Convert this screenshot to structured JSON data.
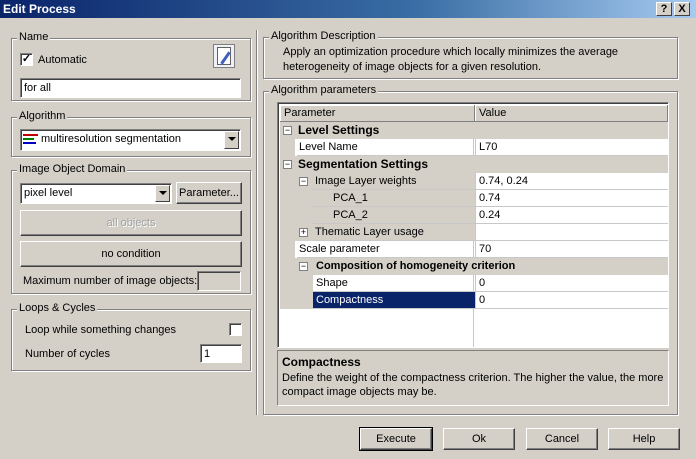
{
  "window": {
    "title": "Edit Process",
    "help_btn": "?",
    "close_btn": "X"
  },
  "name_group": {
    "legend": "Name",
    "automatic_label": "Automatic",
    "automatic_checked": true,
    "value": "for all"
  },
  "algorithm_group": {
    "legend": "Algorithm",
    "selected": "multiresolution segmentation"
  },
  "domain_group": {
    "legend": "Image Object Domain",
    "selected": "pixel level",
    "parameter_btn": "Parameter...",
    "all_objects_btn": "all objects",
    "no_condition_btn": "no condition",
    "max_objects_label": "Maximum number of image objects:"
  },
  "loops_group": {
    "legend": "Loops & Cycles",
    "loop_label": "Loop while something changes",
    "loop_checked": false,
    "cycles_label": "Number of cycles",
    "cycles_value": "1"
  },
  "description_group": {
    "legend": "Algorithm Description",
    "text": "Apply an optimization procedure which locally minimizes the average heterogeneity of image objects for a given resolution."
  },
  "params_group": {
    "legend": "Algorithm parameters",
    "col_parameter": "Parameter",
    "col_value": "Value",
    "rows": [
      {
        "label": "Level Settings",
        "value": ""
      },
      {
        "label": "Level Name",
        "value": "L70"
      },
      {
        "label": "Segmentation Settings",
        "value": ""
      },
      {
        "label": "Image Layer weights",
        "value": "0.74, 0.24"
      },
      {
        "label": "PCA_1",
        "value": "0.74"
      },
      {
        "label": "PCA_2",
        "value": "0.24"
      },
      {
        "label": "Thematic Layer usage",
        "value": ""
      },
      {
        "label": "Scale parameter",
        "value": "70"
      },
      {
        "label": "Composition of homogeneity criterion",
        "value": ""
      },
      {
        "label": "Shape",
        "value": "0"
      },
      {
        "label": "Compactness",
        "value": "0"
      }
    ],
    "help_title": "Compactness",
    "help_text": "Define the weight of the compactness criterion. The higher the value, the more compact image objects may be."
  },
  "footer": {
    "execute": "Execute",
    "ok": "Ok",
    "cancel": "Cancel",
    "help": "Help"
  }
}
